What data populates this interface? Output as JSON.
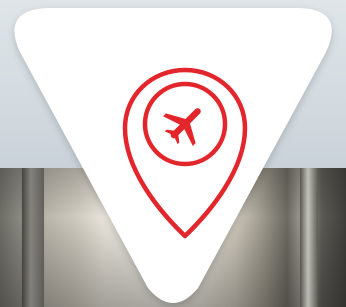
{
  "badge": {
    "shape": "rounded-triangle",
    "fill": "#ffffff",
    "accent": "#e3262c",
    "icon": "airport-location-pin-icon",
    "inner_icon": "airplane-icon"
  }
}
